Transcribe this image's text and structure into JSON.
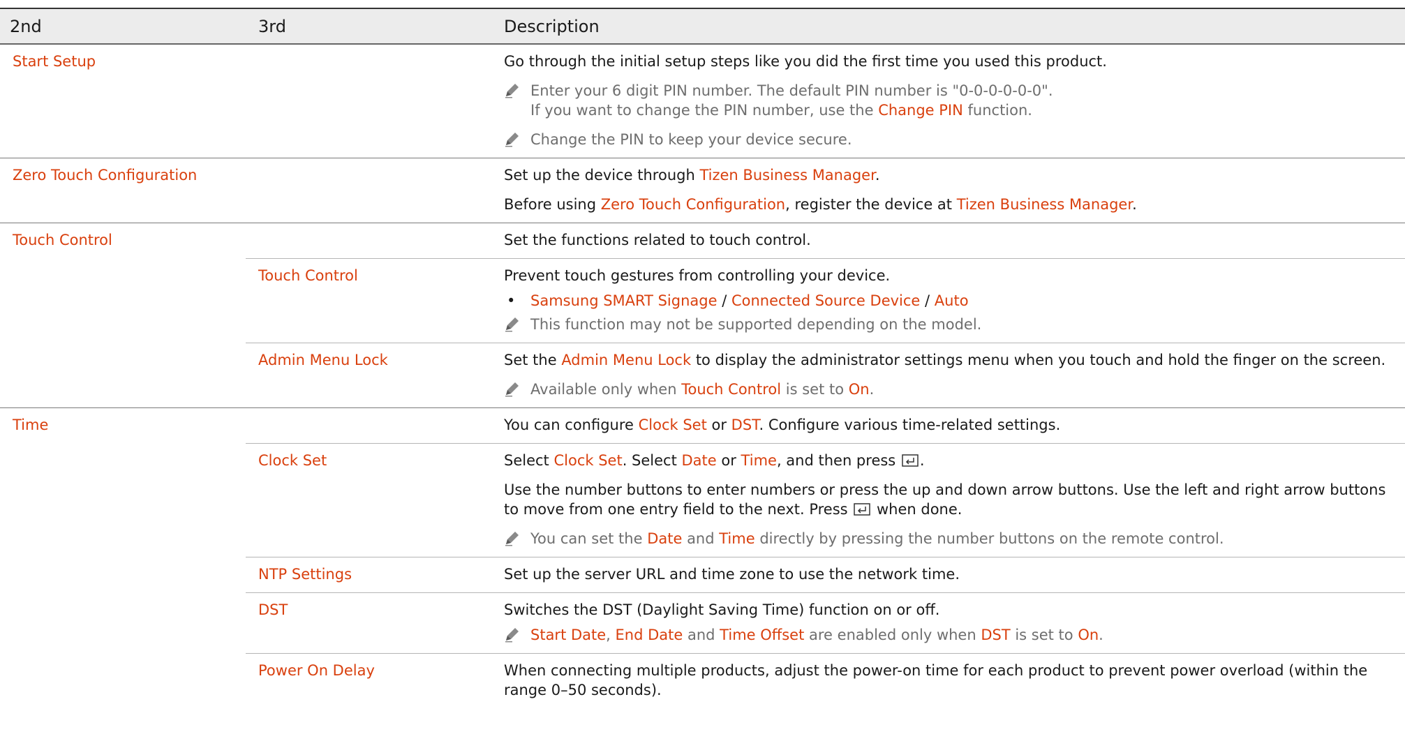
{
  "colors": {
    "accent": "#d9400e",
    "note_text": "#6e6e6e",
    "header_bg": "#ececec"
  },
  "header": {
    "col1": "2nd",
    "col2": "3rd",
    "col3": "Description"
  },
  "start_setup": {
    "name": "Start Setup",
    "desc": "Go through the initial setup steps like you did the first time you used this product.",
    "note1_line1": "Enter your 6 digit PIN number. The default PIN number is \"0-0-0-0-0-0\".",
    "note1_line2_pre": "If you want to change the PIN number, use the ",
    "note1_line2_link": "Change PIN",
    "note1_line2_post": " function.",
    "note2": "Change the PIN to keep your device secure."
  },
  "zero_touch": {
    "name": "Zero Touch Configuration",
    "line1_pre": "Set up the device through ",
    "line1_link": "Tizen Business Manager",
    "line1_post": ".",
    "line2_pre": "Before using ",
    "line2_link1": "Zero Touch Configuration",
    "line2_mid": ", register the device at ",
    "line2_link2": "Tizen Business Manager",
    "line2_post": "."
  },
  "touch_control": {
    "name": "Touch Control",
    "desc": "Set the functions related to touch control.",
    "sub_touch": {
      "name": "Touch Control",
      "desc": "Prevent touch gestures from controlling your device.",
      "opt1": "Samsung SMART Signage",
      "sep1": " / ",
      "opt2": "Connected Source Device",
      "sep2": " / ",
      "opt3": "Auto",
      "note": "This function may not be supported depending on the model."
    },
    "sub_admin": {
      "name": "Admin Menu Lock",
      "desc_pre": "Set the ",
      "desc_link": "Admin Menu Lock",
      "desc_post": " to display the administrator settings menu when you touch and hold the finger on the screen.",
      "note_pre": "Available only when ",
      "note_link1": "Touch Control",
      "note_mid": " is set to ",
      "note_link2": "On",
      "note_post": "."
    }
  },
  "time": {
    "name": "Time",
    "desc_pre": "You can configure ",
    "desc_link1": "Clock Set",
    "desc_mid": " or ",
    "desc_link2": "DST",
    "desc_post": ". Configure various time-related settings.",
    "clock_set": {
      "name": "Clock Set",
      "l1_a": "Select ",
      "l1_b": "Clock Set",
      "l1_c": ". Select ",
      "l1_d": "Date",
      "l1_e": " or ",
      "l1_f": "Time",
      "l1_g": ", and then press ",
      "l1_h": ".",
      "l2_a": "Use the number buttons to enter numbers or press the up and down arrow buttons. Use the left and right arrow buttons to move from one entry field to the next. Press ",
      "l2_b": " when done.",
      "note_a": "You can set the ",
      "note_b": "Date",
      "note_c": " and ",
      "note_d": "Time",
      "note_e": " directly by pressing the number buttons on the remote control."
    },
    "ntp": {
      "name": "NTP Settings",
      "desc": "Set up the server URL and time zone to use the network time."
    },
    "dst": {
      "name": "DST",
      "desc": "Switches the DST (Daylight Saving Time) function on or off.",
      "note_a": "Start Date",
      "note_b": ", ",
      "note_c": "End Date",
      "note_d": " and ",
      "note_e": "Time Offset",
      "note_f": " are enabled only when ",
      "note_g": "DST",
      "note_h": " is set to ",
      "note_i": "On",
      "note_j": "."
    },
    "power_delay": {
      "name": "Power On Delay",
      "desc": "When connecting multiple products, adjust the power-on time for each product to prevent power overload (within the range 0–50 seconds)."
    }
  }
}
